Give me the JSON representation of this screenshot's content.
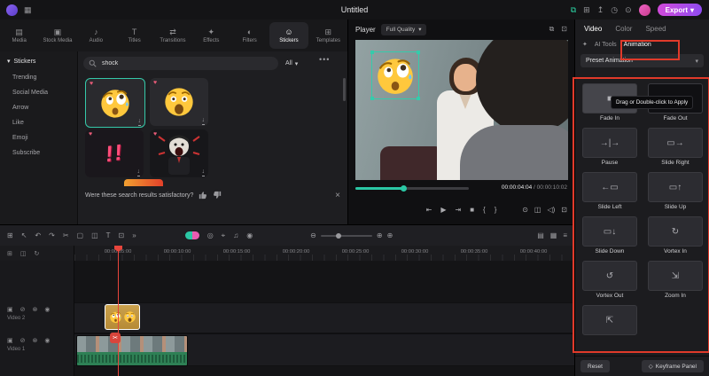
{
  "colors": {
    "accent": "#2bc7a5",
    "annotation": "#e03a2a",
    "export_start": "#d14ad9",
    "export_end": "#8f4bf0"
  },
  "titlebar": {
    "title": "Untitled",
    "export_label": "Export"
  },
  "library": {
    "tabs": [
      {
        "label": "Media"
      },
      {
        "label": "Stock Media"
      },
      {
        "label": "Audio"
      },
      {
        "label": "Titles"
      },
      {
        "label": "Transitions"
      },
      {
        "label": "Effects"
      },
      {
        "label": "Filters"
      },
      {
        "label": "Stickers"
      },
      {
        "label": "Templates"
      }
    ],
    "sidebar_header": "Stickers",
    "sidebar_items": [
      {
        "label": "Trending"
      },
      {
        "label": "Social Media"
      },
      {
        "label": "Arrow"
      },
      {
        "label": "Like"
      },
      {
        "label": "Emoji"
      },
      {
        "label": "Subscribe"
      }
    ],
    "search_value": "shock",
    "filter_label": "All",
    "feedback_text": "Were these search results satisfactory?"
  },
  "player": {
    "label": "Player",
    "quality": "Full Quality",
    "time_current": "00:00:04:04",
    "time_separator": " / ",
    "time_total": "00:00:10:02"
  },
  "props": {
    "tabs": [
      {
        "label": "Video"
      },
      {
        "label": "Color"
      },
      {
        "label": "Speed"
      }
    ],
    "subtabs": [
      {
        "label": "AI Tools"
      },
      {
        "label": "Animation"
      }
    ],
    "dropdown_label": "Preset Animation",
    "tooltip": "Drag or Double-click to Apply",
    "presets": [
      {
        "label": "Fade In",
        "icon": "fade-in",
        "glyph": "■"
      },
      {
        "label": "Fade Out",
        "icon": "fade-out",
        "glyph": "■"
      },
      {
        "label": "Pause",
        "icon": "pause",
        "glyph": "→|→"
      },
      {
        "label": "Slide Right",
        "icon": "slide-right",
        "glyph": "▭→"
      },
      {
        "label": "Slide Left",
        "icon": "slide-left",
        "glyph": "←▭"
      },
      {
        "label": "Slide Up",
        "icon": "slide-up",
        "glyph": "▭↑"
      },
      {
        "label": "Slide Down",
        "icon": "slide-down",
        "glyph": "▭↓"
      },
      {
        "label": "Vortex In",
        "icon": "vortex-in",
        "glyph": "↻"
      },
      {
        "label": "Vortex Out",
        "icon": "vortex-out",
        "glyph": "↺"
      },
      {
        "label": "Zoom In",
        "icon": "zoom-in",
        "glyph": "⇲"
      },
      {
        "label": "",
        "icon": "zoom-out",
        "glyph": "⇱"
      }
    ],
    "reset_label": "Reset",
    "keyframe_label": "Keyframe Panel"
  },
  "timeline": {
    "ruler_labels": [
      {
        "t": "00:00:05:00"
      },
      {
        "t": "00:00:10:00"
      },
      {
        "t": "00:00:15:00"
      },
      {
        "t": "00:00:20:00"
      },
      {
        "t": "00:00:25:00"
      },
      {
        "t": "00:00:30:00"
      },
      {
        "t": "00:00:35:00"
      },
      {
        "t": "00:00:40:00"
      }
    ],
    "tracks": [
      {
        "name": "Video 2"
      },
      {
        "name": "Video 1"
      }
    ]
  }
}
